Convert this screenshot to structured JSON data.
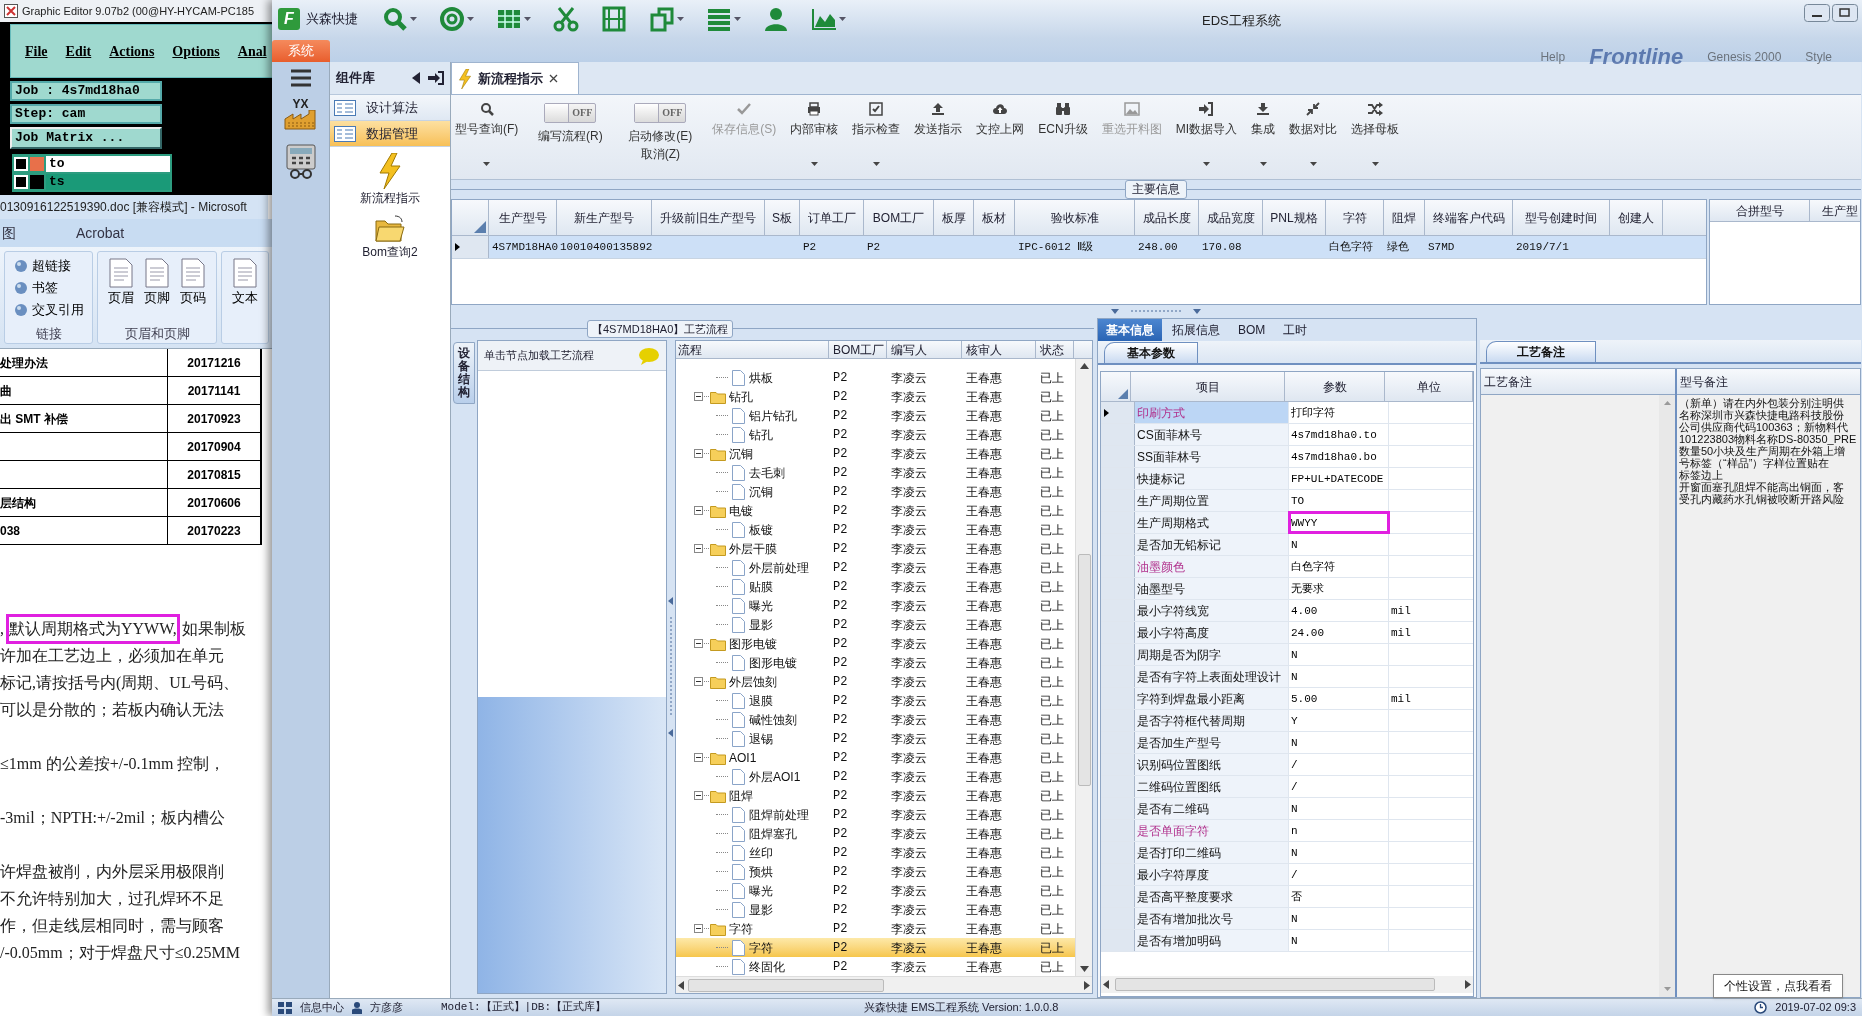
{
  "graphic_editor": {
    "title": "Graphic Editor 9.07b2 (00@HY-HYCAM-PC185",
    "menu": [
      "File",
      "Edit",
      "Actions",
      "Options",
      "Anal"
    ],
    "job": "Job : 4s7md18ha0",
    "step": "Step: cam",
    "job_matrix": "Job Matrix ...",
    "layers": [
      {
        "name": "to",
        "selected": true
      },
      {
        "name": "ts",
        "selected": false
      }
    ]
  },
  "word": {
    "title": "0130916122519390.doc [兼容模式] - Microsoft",
    "tabs": [
      "图",
      "Acrobat"
    ],
    "groups": [
      {
        "kind": "list",
        "label": "链接",
        "items": [
          "超链接",
          "书签",
          "交叉引用"
        ]
      },
      {
        "kind": "large",
        "label": "页眉和页脚",
        "items": [
          "页眉",
          "页脚",
          "页码"
        ]
      },
      {
        "kind": "large",
        "items": [
          "文本"
        ]
      }
    ],
    "table": [
      {
        "text": "处理办法",
        "date": "20171216"
      },
      {
        "text": "曲",
        "date": "20171141"
      },
      {
        "text": "出 SMT 补偿",
        "date": "20170923"
      },
      {
        "date": "20170904"
      },
      {
        "date": "20170815"
      },
      {
        "text": "层结构",
        "date": "20170606"
      },
      {
        "text": "038",
        "date": "20170223"
      }
    ],
    "paragraphs": [
      [
        [
          {
            "text": ",",
            "boxed": false
          },
          {
            "text": "默认周期格式为YYWW,",
            "boxed": true
          },
          {
            "text": "如果制板",
            "boxed": false
          }
        ],
        [
          {
            "text": "许加在工艺边上，必须加在单元",
            "boxed": false
          }
        ],
        [
          {
            "text": "标记,请按括号内(周期、UL号码、",
            "boxed": false
          }
        ],
        [
          {
            "text": "可以是分散的；若板内确认无法",
            "boxed": false
          }
        ]
      ],
      [
        [
          {
            "text": "≤1mm 的公差按+/-0.1mm 控制，",
            "boxed": false
          }
        ]
      ],
      [
        [
          {
            "text": "-3mil；NPTH:+/-2mil；板内槽公",
            "boxed": false
          }
        ]
      ],
      [
        [
          {
            "text": "许焊盘被削，内外层采用极限削",
            "boxed": false
          }
        ],
        [
          {
            "text": "不允许特别加大，过孔焊环不足",
            "boxed": false
          }
        ],
        [
          {
            "text": "作，但走线层相同时，需与顾客",
            "boxed": false
          }
        ],
        [
          {
            "text": "/-0.05mm；对于焊盘尺寸≤0.25MM",
            "boxed": false
          }
        ]
      ]
    ]
  },
  "app": {
    "logo": "F",
    "name": "兴森快捷",
    "title": "EDS工程系统",
    "system_tab": "系统",
    "backdrop": [
      "Help",
      "Frontline",
      "Genesis 2000",
      "Style"
    ],
    "side_badge": "YX"
  },
  "components": {
    "title": "组件库",
    "items": [
      {
        "label": "设计算法",
        "selected": false
      },
      {
        "label": "数据管理",
        "selected": true
      }
    ],
    "shortcuts": [
      "新流程指示",
      "Bom查询2"
    ]
  },
  "doc_tab": {
    "label": "新流程指示"
  },
  "ribbon": [
    {
      "kind": "button",
      "label": "型号查询(F)",
      "dropdown": true,
      "disabled": false
    },
    {
      "kind": "toggle",
      "label": "编写流程(R)",
      "switch_text": "OFF",
      "on": false
    },
    {
      "kind": "toggle",
      "label": "启动修改(E)",
      "label_2": "取消(Z)",
      "switch_text": "OFF",
      "on": false
    },
    {
      "kind": "button",
      "label": "保存信息(S)",
      "dropdown": false,
      "disabled": true
    },
    {
      "kind": "button",
      "label": "内部审核",
      "dropdown": true,
      "disabled": false
    },
    {
      "kind": "button",
      "label": "指示检查",
      "dropdown": true,
      "disabled": false
    },
    {
      "kind": "button",
      "label": "发送指示",
      "dropdown": false,
      "disabled": false
    },
    {
      "kind": "button",
      "label": "文控上网",
      "dropdown": false,
      "disabled": false
    },
    {
      "kind": "button",
      "label": "ECN升级",
      "dropdown": false,
      "disabled": false
    },
    {
      "kind": "button",
      "label": "重选开料图",
      "dropdown": false,
      "disabled": true
    },
    {
      "kind": "button",
      "label": "MI数据导入",
      "dropdown": true,
      "disabled": false
    },
    {
      "kind": "button",
      "label": "集成",
      "dropdown": true,
      "disabled": false
    },
    {
      "kind": "button",
      "label": "数据对比",
      "dropdown": true,
      "disabled": false
    },
    {
      "kind": "button",
      "label": "选择母板",
      "dropdown": true,
      "disabled": false
    }
  ],
  "main_info": {
    "legend": "主要信息",
    "columns": [
      "生产型号",
      "新生产型号",
      "升级前旧生产型号",
      "S板",
      "订单工厂",
      "BOM工厂",
      "板厚",
      "板材",
      "验收标准",
      "成品长度",
      "成品宽度",
      "PNL规格",
      "字符",
      "阻焊",
      "终端客户代码",
      "型号创建时间",
      "创建人"
    ],
    "rows": [
      {
        "selected": true,
        "cells": [
          "4S7MD18HA0",
          "10010400135892",
          null,
          null,
          "P2",
          "P2",
          null,
          null,
          "IPC-6012 Ⅱ级",
          "248.00",
          "170.08",
          null,
          "白色字符",
          "绿色",
          "S7MD",
          "2019/7/1",
          null
        ]
      }
    ],
    "side_columns": [
      "合拼型号",
      "生产型"
    ]
  },
  "process": {
    "legend": "【4S7MD18HA0】工艺流程",
    "side_tab": "设备结构",
    "hint": "单击节点加载工艺流程",
    "columns": [
      "流程",
      "BOM工厂",
      "编写人",
      "核审人",
      "状态"
    ],
    "rows": [
      {
        "kind": "file",
        "label": "烘板",
        "bom": "P2",
        "writer": "李凌云",
        "reviewer": "王春惠",
        "status": "已上",
        "selected": false
      },
      {
        "kind": "folder",
        "label": "钻孔",
        "bom": "P2",
        "writer": "李凌云",
        "reviewer": "王春惠",
        "status": "已上",
        "selected": false,
        "expanded": true,
        "children": [
          {
            "kind": "file",
            "label": "铝片钻孔",
            "bom": "P2",
            "writer": "李凌云",
            "reviewer": "王春惠",
            "status": "已上",
            "selected": false
          },
          {
            "kind": "file",
            "label": "钻孔",
            "bom": "P2",
            "writer": "李凌云",
            "reviewer": "王春惠",
            "status": "已上",
            "selected": false
          }
        ]
      },
      {
        "kind": "folder",
        "label": "沉铜",
        "bom": "P2",
        "writer": "李凌云",
        "reviewer": "王春惠",
        "status": "已上",
        "selected": false,
        "expanded": true,
        "children": [
          {
            "kind": "file",
            "label": "去毛刺",
            "bom": "P2",
            "writer": "李凌云",
            "reviewer": "王春惠",
            "status": "已上",
            "selected": false
          },
          {
            "kind": "file",
            "label": "沉铜",
            "bom": "P2",
            "writer": "李凌云",
            "reviewer": "王春惠",
            "status": "已上",
            "selected": false
          }
        ]
      },
      {
        "kind": "folder",
        "label": "电镀",
        "bom": "P2",
        "writer": "李凌云",
        "reviewer": "王春惠",
        "status": "已上",
        "selected": false,
        "expanded": true,
        "children": [
          {
            "kind": "file",
            "label": "板镀",
            "bom": "P2",
            "writer": "李凌云",
            "reviewer": "王春惠",
            "status": "已上",
            "selected": false
          }
        ]
      },
      {
        "kind": "folder",
        "label": "外层干膜",
        "bom": "P2",
        "writer": "李凌云",
        "reviewer": "王春惠",
        "status": "已上",
        "selected": false,
        "expanded": true,
        "children": [
          {
            "kind": "file",
            "label": "外层前处理",
            "bom": "P2",
            "writer": "李凌云",
            "reviewer": "王春惠",
            "status": "已上",
            "selected": false
          },
          {
            "kind": "file",
            "label": "贴膜",
            "bom": "P2",
            "writer": "李凌云",
            "reviewer": "王春惠",
            "status": "已上",
            "selected": false
          },
          {
            "kind": "file",
            "label": "曝光",
            "bom": "P2",
            "writer": "李凌云",
            "reviewer": "王春惠",
            "status": "已上",
            "selected": false
          },
          {
            "kind": "file",
            "label": "显影",
            "bom": "P2",
            "writer": "李凌云",
            "reviewer": "王春惠",
            "status": "已上",
            "selected": false
          }
        ]
      },
      {
        "kind": "folder",
        "label": "图形电镀",
        "bom": "P2",
        "writer": "李凌云",
        "reviewer": "王春惠",
        "status": "已上",
        "selected": false,
        "expanded": true,
        "children": [
          {
            "kind": "file",
            "label": "图形电镀",
            "bom": "P2",
            "writer": "李凌云",
            "reviewer": "王春惠",
            "status": "已上",
            "selected": false
          }
        ]
      },
      {
        "kind": "folder",
        "label": "外层蚀刻",
        "bom": "P2",
        "writer": "李凌云",
        "reviewer": "王春惠",
        "status": "已上",
        "selected": false,
        "expanded": true,
        "children": [
          {
            "kind": "file",
            "label": "退膜",
            "bom": "P2",
            "writer": "李凌云",
            "reviewer": "王春惠",
            "status": "已上",
            "selected": false
          },
          {
            "kind": "file",
            "label": "碱性蚀刻",
            "bom": "P2",
            "writer": "李凌云",
            "reviewer": "王春惠",
            "status": "已上",
            "selected": false
          },
          {
            "kind": "file",
            "label": "退锡",
            "bom": "P2",
            "writer": "李凌云",
            "reviewer": "王春惠",
            "status": "已上",
            "selected": false
          }
        ]
      },
      {
        "kind": "folder",
        "label": "AOI1",
        "bom": "P2",
        "writer": "李凌云",
        "reviewer": "王春惠",
        "status": "已上",
        "selected": false,
        "expanded": true,
        "children": [
          {
            "kind": "file",
            "label": "外层AOI1",
            "bom": "P2",
            "writer": "李凌云",
            "reviewer": "王春惠",
            "status": "已上",
            "selected": false
          }
        ]
      },
      {
        "kind": "folder",
        "label": "阻焊",
        "bom": "P2",
        "writer": "李凌云",
        "reviewer": "王春惠",
        "status": "已上",
        "selected": false,
        "expanded": true,
        "children": [
          {
            "kind": "file",
            "label": "阻焊前处理",
            "bom": "P2",
            "writer": "李凌云",
            "reviewer": "王春惠",
            "status": "已上",
            "selected": false
          },
          {
            "kind": "file",
            "label": "阻焊塞孔",
            "bom": "P2",
            "writer": "李凌云",
            "reviewer": "王春惠",
            "status": "已上",
            "selected": false
          },
          {
            "kind": "file",
            "label": "丝印",
            "bom": "P2",
            "writer": "李凌云",
            "reviewer": "王春惠",
            "status": "已上",
            "selected": false
          },
          {
            "kind": "file",
            "label": "预烘",
            "bom": "P2",
            "writer": "李凌云",
            "reviewer": "王春惠",
            "status": "已上",
            "selected": false
          },
          {
            "kind": "file",
            "label": "曝光",
            "bom": "P2",
            "writer": "李凌云",
            "reviewer": "王春惠",
            "status": "已上",
            "selected": false
          },
          {
            "kind": "file",
            "label": "显影",
            "bom": "P2",
            "writer": "李凌云",
            "reviewer": "王春惠",
            "status": "已上",
            "selected": false
          }
        ]
      },
      {
        "kind": "folder",
        "label": "字符",
        "bom": "P2",
        "writer": "李凌云",
        "reviewer": "王春惠",
        "status": "已上",
        "selected": false,
        "expanded": true,
        "children": [
          {
            "kind": "file",
            "label": "字符",
            "bom": "P2",
            "writer": "李凌云",
            "reviewer": "王春惠",
            "status": "已上",
            "selected": true
          },
          {
            "kind": "file",
            "label": "终固化",
            "bom": "P2",
            "writer": "李凌云",
            "reviewer": "王春惠",
            "status": "已上",
            "selected": false
          }
        ]
      }
    ]
  },
  "basic": {
    "tabs": [
      {
        "label": "基本信息",
        "selected": true
      },
      {
        "label": "拓展信息",
        "selected": false
      },
      {
        "label": "BOM",
        "selected": false
      },
      {
        "label": "工时",
        "selected": false
      }
    ],
    "subtab": "基本参数",
    "columns": [
      "项目",
      "参数",
      "单位"
    ],
    "rows": [
      {
        "item": "印刷方式",
        "value": "打印字符",
        "emphasis": true,
        "selected": true,
        "boxed": false
      },
      {
        "item": "CS面菲林号",
        "value": "4s7md18ha0.to",
        "emphasis": false,
        "selected": false,
        "boxed": false
      },
      {
        "item": "SS面菲林号",
        "value": "4s7md18ha0.bo",
        "emphasis": false,
        "selected": false,
        "boxed": false
      },
      {
        "item": "快捷标记",
        "value": "FP+UL+DATECODE",
        "emphasis": false,
        "selected": false,
        "boxed": false
      },
      {
        "item": "生产周期位置",
        "value": "TO",
        "emphasis": false,
        "selected": false,
        "boxed": false
      },
      {
        "item": "生产周期格式",
        "value": "WWYY",
        "emphasis": false,
        "selected": false,
        "boxed": true
      },
      {
        "item": "是否加无铅标记",
        "value": "N",
        "emphasis": false,
        "selected": false,
        "boxed": false
      },
      {
        "item": "油墨颜色",
        "value": "白色字符",
        "emphasis": true,
        "selected": false,
        "boxed": false
      },
      {
        "item": "油墨型号",
        "value": "无要求",
        "emphasis": false,
        "selected": false,
        "boxed": false
      },
      {
        "item": "最小字符线宽",
        "value": "4.00",
        "unit": "mil",
        "emphasis": false,
        "selected": false,
        "boxed": false
      },
      {
        "item": "最小字符高度",
        "value": "24.00",
        "unit": "mil",
        "emphasis": false,
        "selected": false,
        "boxed": false
      },
      {
        "item": "周期是否为阴字",
        "value": "N",
        "emphasis": false,
        "selected": false,
        "boxed": false
      },
      {
        "item": "是否有字符上表面处理设计",
        "value": "N",
        "emphasis": false,
        "selected": false,
        "boxed": false
      },
      {
        "item": "字符到焊盘最小距离",
        "value": "5.00",
        "unit": "mil",
        "emphasis": false,
        "selected": false,
        "boxed": false
      },
      {
        "item": "是否字符框代替周期",
        "value": "Y",
        "emphasis": false,
        "selected": false,
        "boxed": false
      },
      {
        "item": "是否加生产型号",
        "value": "N",
        "emphasis": false,
        "selected": false,
        "boxed": false
      },
      {
        "item": "识别码位置图纸",
        "value": "/",
        "emphasis": false,
        "selected": false,
        "boxed": false
      },
      {
        "item": "二维码位置图纸",
        "value": "/",
        "emphasis": false,
        "selected": false,
        "boxed": false
      },
      {
        "item": "是否有二维码",
        "value": "N",
        "emphasis": false,
        "selected": false,
        "boxed": false
      },
      {
        "item": "是否单面字符",
        "value": "n",
        "emphasis": true,
        "selected": false,
        "boxed": false
      },
      {
        "item": "是否打印二维码",
        "value": "N",
        "emphasis": false,
        "selected": false,
        "boxed": false
      },
      {
        "item": "最小字符厚度",
        "value": "/",
        "emphasis": false,
        "selected": false,
        "boxed": false
      },
      {
        "item": "是否高平整度要求",
        "value": "否",
        "emphasis": false,
        "selected": false,
        "boxed": false
      },
      {
        "item": "是否有增加批次号",
        "value": "N",
        "emphasis": false,
        "selected": false,
        "boxed": false
      },
      {
        "item": "是否有增加明码",
        "value": "N",
        "emphasis": false,
        "selected": false,
        "boxed": false
      }
    ]
  },
  "notes": {
    "tab": "工艺备注",
    "columns": [
      "工艺备注",
      "型号备注"
    ],
    "lines": [
      "（新单）请在内外包装分别注明供",
      "名称深圳市兴森快捷电路科技股份",
      "公司供应商代码100363；新物料代",
      "101223803物料名称DS-80350_PRE",
      "数量50小块及生产周期在外箱上增",
      "号标签（“样品”）字样位置贴在",
      "标签边上",
      "开窗面塞孔阻焊不能高出铜面，客",
      "受孔内藏药水孔铜被咬断开路风险"
    ]
  },
  "tooltip": "个性设置，点我看看",
  "status_bar": {
    "info": "信息中心",
    "user": "方彦彦",
    "model": "Model:【正式】|DB:【正式库】",
    "version": "兴森快捷 EMS工程系统 Version: 1.0.0.8",
    "time": "2019-07-02 09:3"
  }
}
